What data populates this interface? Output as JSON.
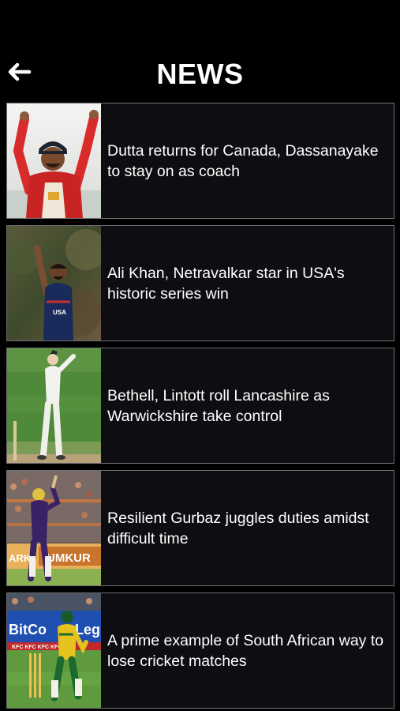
{
  "header": {
    "title": "NEWS",
    "back_icon": "arrow-left-icon"
  },
  "news": [
    {
      "headline": "Dutta returns for Canada, Dassanayake to stay on as coach",
      "thumbnail": "player-celebrating-photo"
    },
    {
      "headline": "Ali Khan, Netravalkar star in USA's historic series win",
      "thumbnail": "usa-bowler-appeal-photo"
    },
    {
      "headline": "Bethell, Lintott roll Lancashire as Warwickshire take control",
      "thumbnail": "county-fielder-photo"
    },
    {
      "headline": "Resilient Gurbaz juggles duties amidst difficult time",
      "thumbnail": "kkr-batter-stadium-photo",
      "thumbnail_text": "UMKUR"
    },
    {
      "headline": "A prime example of South African way to lose cricket matches",
      "thumbnail": "sa-batter-photo",
      "thumbnail_text": "BitCo"
    }
  ],
  "colors": {
    "background": "#000000",
    "card_background": "#0e0e12",
    "card_border": "#6f6f74",
    "text": "#ffffff"
  }
}
